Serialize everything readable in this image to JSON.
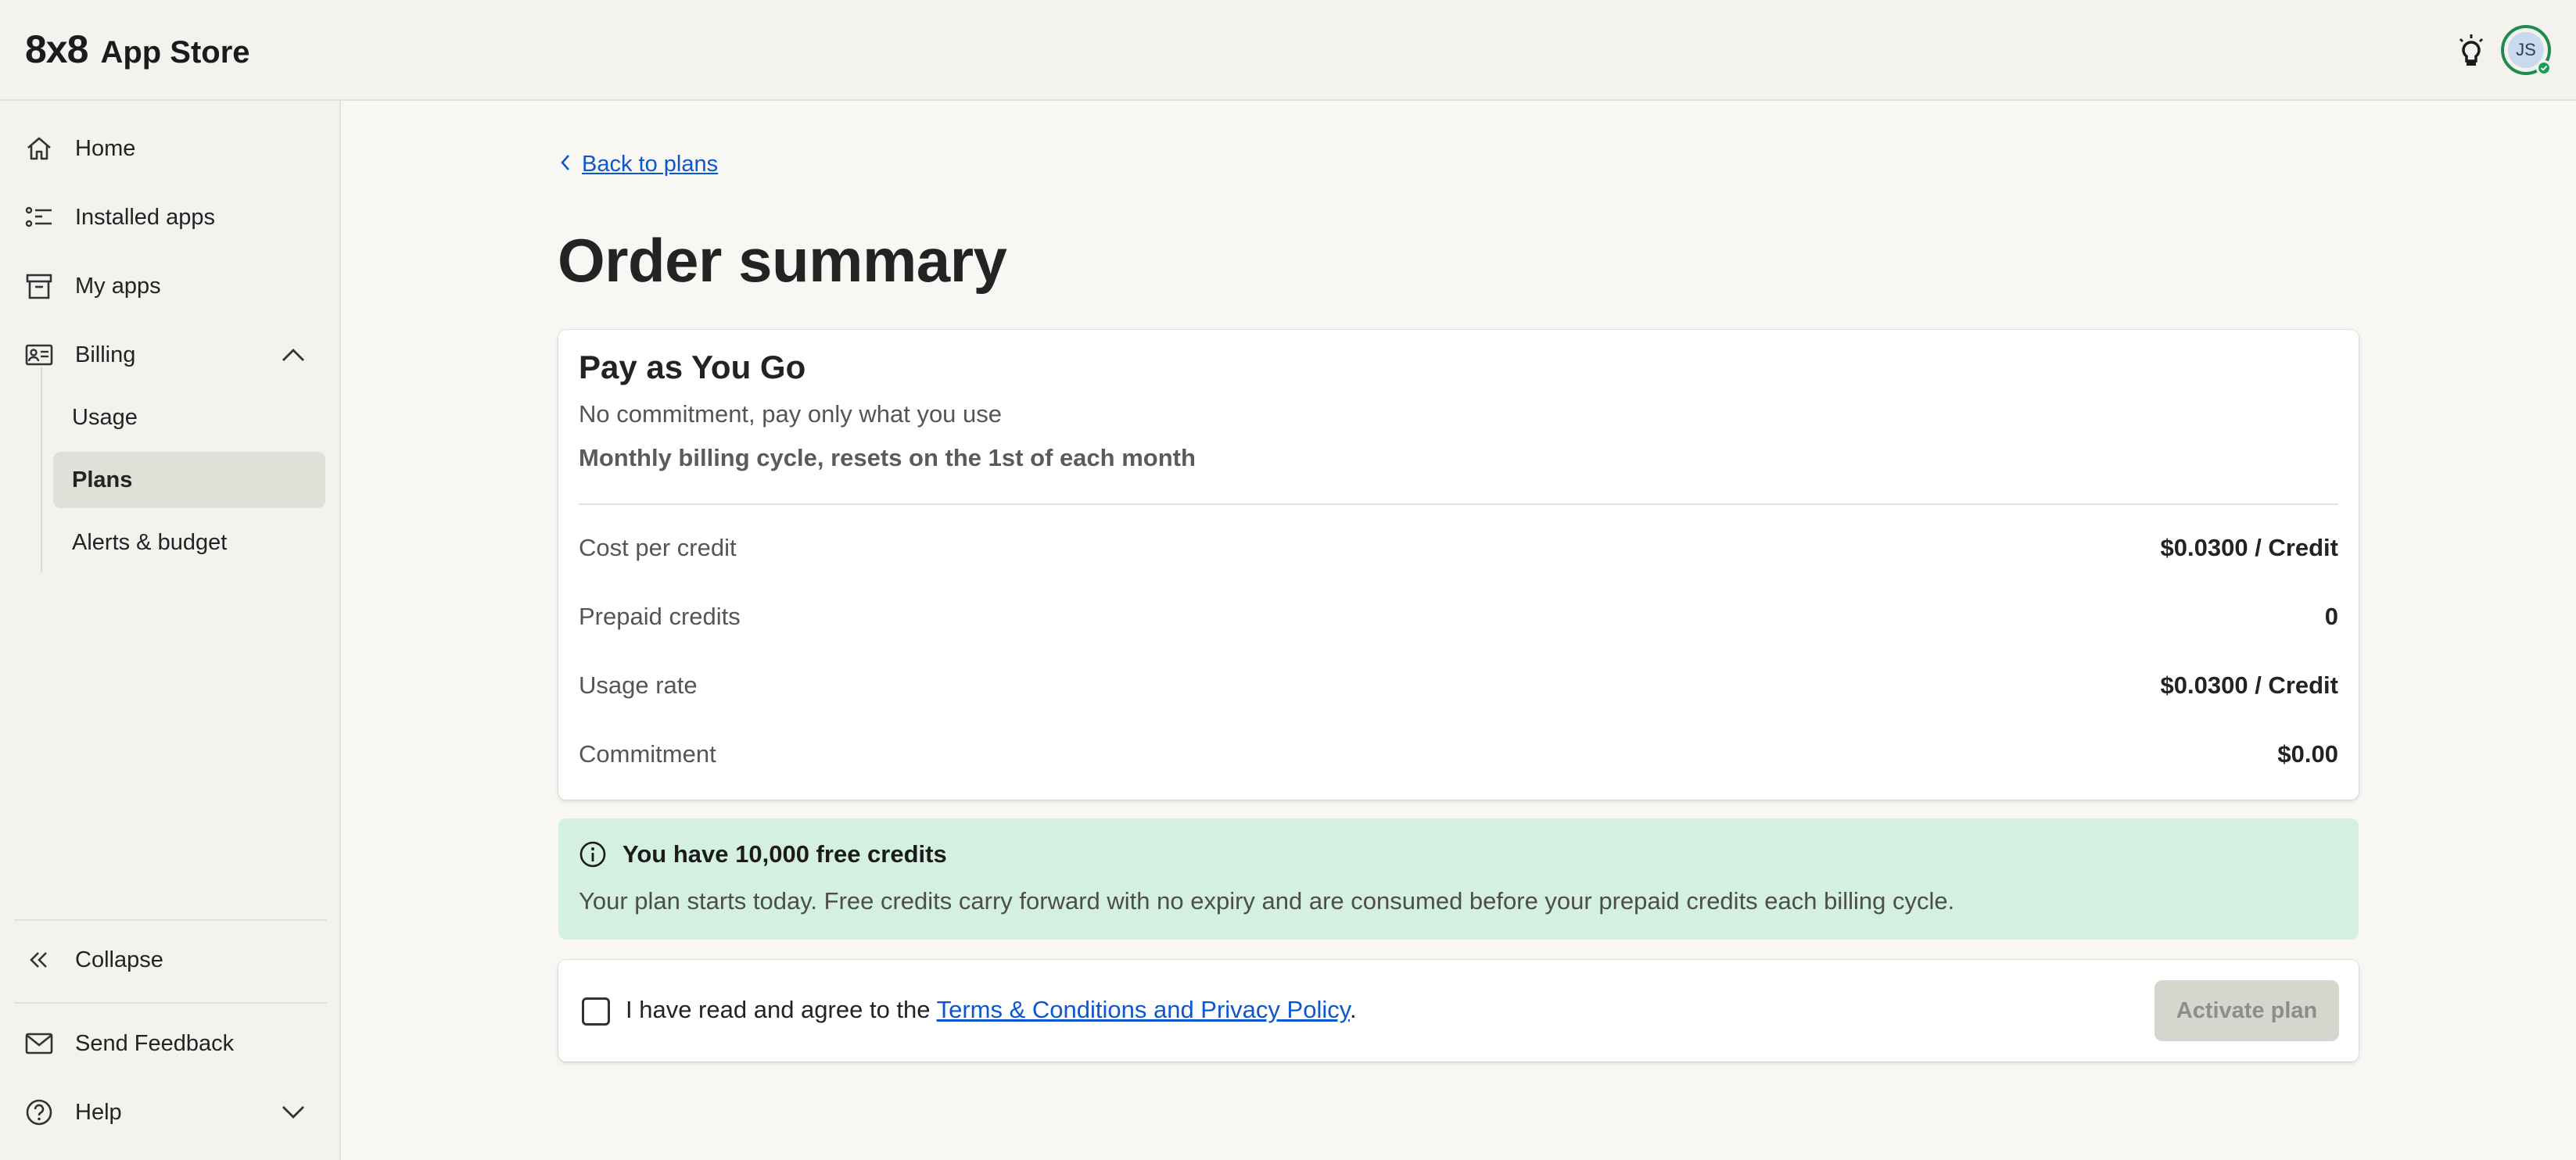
{
  "app": {
    "logo": "8x8",
    "name": "App Store",
    "user_initials": "JS",
    "colors": {
      "accent_green": "#1f9d57",
      "link_blue": "#0b57d0",
      "notice_bg": "#d3f0e1"
    }
  },
  "sidebar": {
    "items": [
      {
        "label": "Home",
        "icon": "home-icon"
      },
      {
        "label": "Installed apps",
        "icon": "list-icon"
      },
      {
        "label": "My apps",
        "icon": "archive-icon"
      },
      {
        "label": "Billing",
        "icon": "id-card-icon"
      }
    ],
    "billing_sub": [
      {
        "label": "Usage"
      },
      {
        "label": "Plans",
        "active": true
      },
      {
        "label": "Alerts & budget"
      }
    ],
    "collapse_label": "Collapse",
    "feedback_label": "Send Feedback",
    "help_label": "Help"
  },
  "main": {
    "back_label": "Back to plans",
    "title": "Order summary",
    "plan": {
      "name": "Pay as You Go",
      "description": "No commitment, pay only what you use",
      "cycle": "Monthly billing cycle, resets on the 1st of each month",
      "rows": [
        {
          "label": "Cost per credit",
          "value": "$0.0300 / Credit"
        },
        {
          "label": "Prepaid credits",
          "value": "0"
        },
        {
          "label": "Usage rate",
          "value": "$0.0300 / Credit"
        },
        {
          "label": "Commitment",
          "value": "$0.00"
        }
      ]
    },
    "notice": {
      "title": "You have 10,000 free credits",
      "text": "Your plan starts today. Free credits carry forward with no expiry and are consumed before your prepaid credits each billing cycle."
    },
    "agreement": {
      "prefix": "I have read and agree to the ",
      "link": "Terms & Conditions and Privacy Policy",
      "suffix": ".",
      "checked": false,
      "button_label": "Activate plan"
    }
  }
}
